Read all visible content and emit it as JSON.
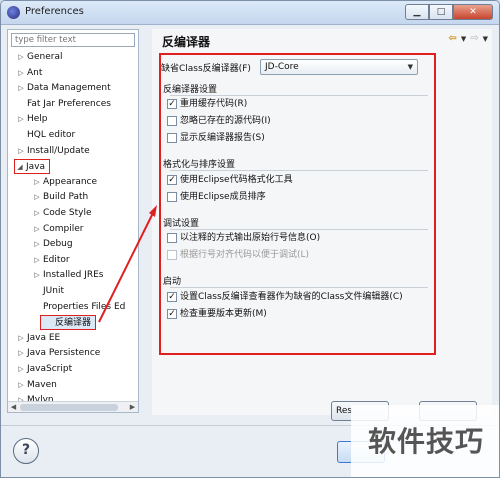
{
  "window": {
    "title": "Preferences"
  },
  "filter": {
    "placeholder": "type filter text"
  },
  "tree": {
    "items": [
      {
        "label": "General",
        "expander": "▷"
      },
      {
        "label": "Ant",
        "expander": "▷"
      },
      {
        "label": "Data Management",
        "expander": "▷"
      },
      {
        "label": "Fat Jar Preferences",
        "expander": ""
      },
      {
        "label": "Help",
        "expander": "▷"
      },
      {
        "label": "HQL editor",
        "expander": ""
      },
      {
        "label": "Install/Update",
        "expander": "▷"
      },
      {
        "label": "Java",
        "expander": "◢"
      },
      {
        "label": "Appearance",
        "expander": "▷"
      },
      {
        "label": "Build Path",
        "expander": "▷"
      },
      {
        "label": "Code Style",
        "expander": "▷"
      },
      {
        "label": "Compiler",
        "expander": "▷"
      },
      {
        "label": "Debug",
        "expander": "▷"
      },
      {
        "label": "Editor",
        "expander": "▷"
      },
      {
        "label": "Installed JREs",
        "expander": "▷"
      },
      {
        "label": "JUnit",
        "expander": ""
      },
      {
        "label": "Properties Files Ed",
        "expander": ""
      },
      {
        "label": "反编译器",
        "expander": ""
      },
      {
        "label": "Java EE",
        "expander": "▷"
      },
      {
        "label": "Java Persistence",
        "expander": "▷"
      },
      {
        "label": "JavaScript",
        "expander": "▷"
      },
      {
        "label": "Maven",
        "expander": "▷"
      },
      {
        "label": "Mylyn",
        "expander": "▷"
      }
    ]
  },
  "page": {
    "title": "反编译器",
    "default_label": "缺省Class反编译器(F)",
    "default_value": "JD-Core",
    "groups": {
      "decompiler": {
        "title": "反编译器设置",
        "options": [
          {
            "label": "重用缓存代码(R)",
            "checked": true
          },
          {
            "label": "忽略已存在的源代码(I)",
            "checked": false
          },
          {
            "label": "显示反编译器报告(S)",
            "checked": false
          }
        ]
      },
      "format": {
        "title": "格式化与排序设置",
        "options": [
          {
            "label": "使用Eclipse代码格式化工具",
            "checked": true
          },
          {
            "label": "使用Eclipse成员排序",
            "checked": false
          }
        ]
      },
      "debug": {
        "title": "调试设置",
        "options": [
          {
            "label": "以注释的方式输出原始行号信息(O)",
            "checked": false
          },
          {
            "label": "根据行号对齐代码以便于调试(L)",
            "checked": false,
            "disabled": true
          }
        ]
      },
      "startup": {
        "title": "启动",
        "options": [
          {
            "label": "设置Class反编译查看器作为缺省的Class文件编辑器(C)",
            "checked": true
          },
          {
            "label": "检查重要版本更新(M)",
            "checked": true
          }
        ]
      }
    }
  },
  "buttons": {
    "restore": "Res",
    "help": "?"
  },
  "watermark": "软件技巧",
  "colors": {
    "annotation": "#e02020",
    "selection": "#dbe8f6"
  }
}
